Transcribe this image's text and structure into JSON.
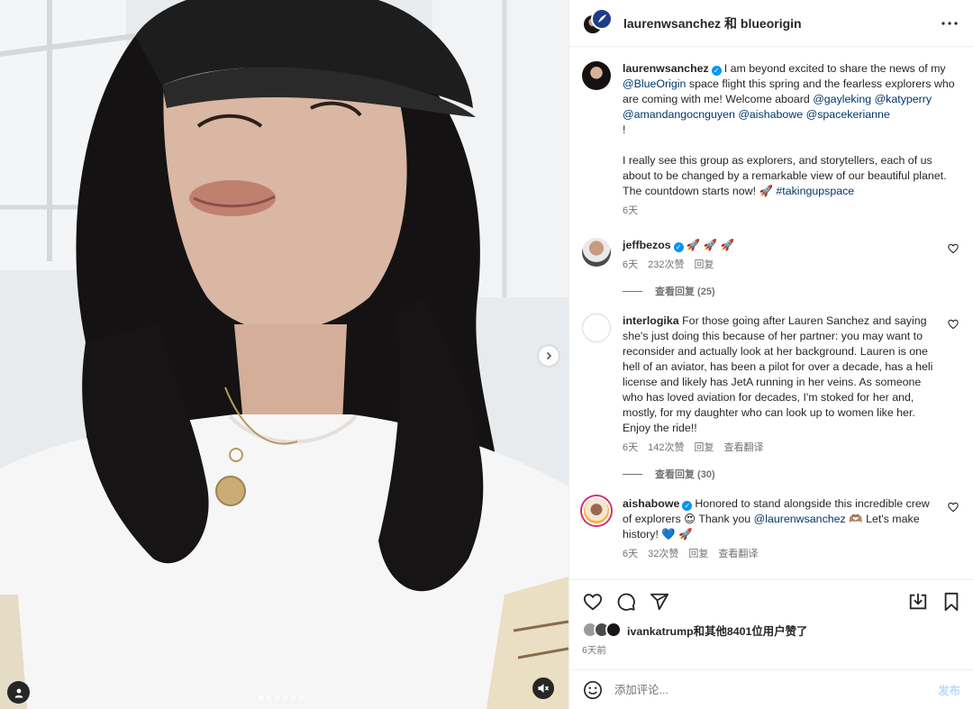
{
  "header": {
    "title": "laurenwsanchez 和 blueorigin"
  },
  "caption": {
    "username": "laurenwsanchez",
    "text_1": "I am beyond excited to share the news of my ",
    "mention_1": "@BlueOrigin",
    "text_2": " space flight this spring and the fearless explorers who are coming with me! Welcome aboard ",
    "mention_2": "@gayleking",
    "mention_3": "@katyperry",
    "mention_4": "@amandangocnguyen",
    "mention_5": "@aishabowe",
    "mention_6": "@spacekerianne",
    "text_3": "!",
    "paragraph_2": "I really see this group as explorers, and storytellers, each of us about to be changed by a remarkable view of our beautiful planet. The countdown starts now! 🚀 ",
    "hashtag": "#takingupspace",
    "time": "6天"
  },
  "comments": [
    {
      "username": "jeffbezos",
      "text": "🚀 🚀 🚀",
      "time": "6天",
      "likes": "232次赞",
      "reply": "回复",
      "view_replies": "查看回复 (25)"
    },
    {
      "username": "interlogika",
      "text": "For those going after Lauren Sanchez and saying she's just doing this because of her partner: you may want to reconsider and actually look at her background. Lauren is one hell of an aviator, has been a pilot for over a decade, has a heli license and likely has JetA running in her veins. As someone who has loved aviation for decades, I'm stoked for her and, mostly, for my daughter who can look up to women like her. Enjoy the ride!!",
      "time": "6天",
      "likes": "142次赞",
      "reply": "回复",
      "translate": "查看翻译",
      "view_replies": "查看回复 (30)"
    },
    {
      "username": "aishabowe",
      "text_1": "Honored to stand alongside this incredible crew of explorers 😍 Thank you ",
      "mention": "@laurenwsanchez",
      "text_2": " 🫶🏽 Let's make history! 💙 🚀",
      "time": "6天",
      "likes": "32次赞",
      "reply": "回复",
      "translate": "查看翻译"
    }
  ],
  "likes_summary": "ivankatrump和其他8401位用户赞了",
  "post_time": "6天前",
  "comment_box": {
    "placeholder": "添加评论...",
    "post_label": "发布"
  },
  "icons": {
    "like": "heart-icon",
    "comment": "comment-icon",
    "share": "send-icon",
    "save": "bookmark-icon",
    "download": "download-icon",
    "mute": "speaker-muted-icon",
    "tag": "user-tag-icon",
    "next": "chevron-right-icon",
    "emoji": "emoji-icon",
    "more": "more-horizontal-icon"
  },
  "carousel": {
    "slides": 6,
    "active": 1
  },
  "colors": {
    "link": "#00376b",
    "verified": "#0095f6",
    "muted": "#737373",
    "post_disabled": "#b3dbff"
  }
}
